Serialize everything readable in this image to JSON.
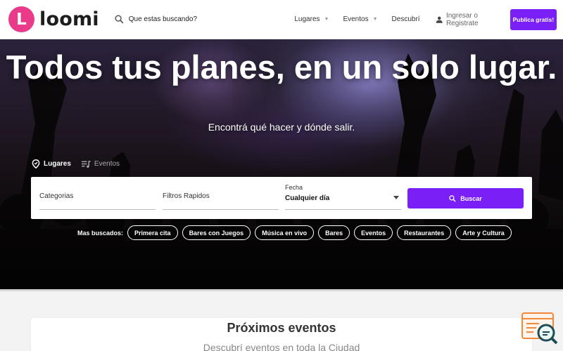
{
  "brand": {
    "logo_letter": "L",
    "name": "loomi",
    "color": "#ea3a8a"
  },
  "search": {
    "placeholder": "Que estas buscando?"
  },
  "nav": {
    "items": [
      {
        "label": "Lugares",
        "has_dropdown": true
      },
      {
        "label": "Eventos",
        "has_dropdown": true
      },
      {
        "label": "Descubrí",
        "has_dropdown": false
      }
    ],
    "login_label": "Ingresar o Registrate",
    "publish_label": "Publica gratis!",
    "accent_color": "#7a1ff6"
  },
  "hero": {
    "title": "Todos tus planes, en un solo lugar.",
    "subtitle": "Encontrá qué hacer y dónde salir."
  },
  "tabs": [
    {
      "label": "Lugares",
      "icon": "map-pin-icon",
      "active": true
    },
    {
      "label": "Eventos",
      "icon": "music-list-icon",
      "active": false
    }
  ],
  "filters": {
    "categories_label": "Categorias",
    "quick_filters_label": "Filtros Rapidos",
    "date_label": "Fecha",
    "date_value": "Cualquier día",
    "search_button": "Buscar"
  },
  "popular": {
    "label": "Mas buscados:",
    "chips": [
      "Primera cita",
      "Bares con Juegos",
      "Música en vivo",
      "Bares",
      "Eventos",
      "Restaurantes",
      "Arte y Cultura"
    ]
  },
  "upcoming": {
    "title": "Próximos eventos",
    "subtitle": "Descubrí eventos en toda la Ciudad"
  }
}
